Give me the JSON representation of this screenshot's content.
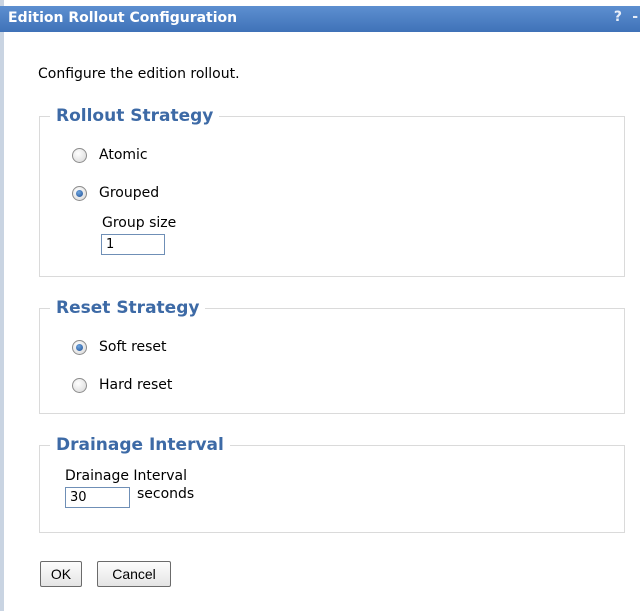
{
  "dialog": {
    "title": "Edition Rollout Configuration",
    "help_glyph": "?",
    "extra_glyph": "-",
    "intro": "Configure the edition rollout."
  },
  "rollout_strategy": {
    "legend": "Rollout Strategy",
    "options": [
      {
        "label": "Atomic",
        "checked": false
      },
      {
        "label": "Grouped",
        "checked": true
      }
    ],
    "group_size_label": "Group size",
    "group_size_value": "1"
  },
  "reset_strategy": {
    "legend": "Reset Strategy",
    "options": [
      {
        "label": "Soft reset",
        "checked": true
      },
      {
        "label": "Hard reset",
        "checked": false
      }
    ]
  },
  "drainage": {
    "legend": "Drainage Interval",
    "field_label": "Drainage Interval",
    "value": "30",
    "unit": "seconds"
  },
  "buttons": {
    "ok": "OK",
    "cancel": "Cancel"
  },
  "colors": {
    "title_bar": "#4a7dc2",
    "legend_text": "#3d6aa6"
  }
}
